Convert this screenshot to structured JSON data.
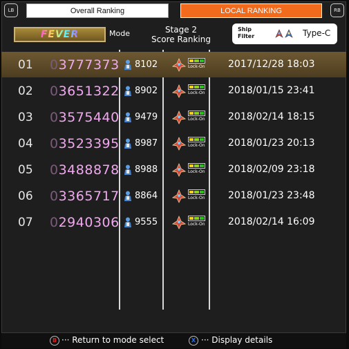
{
  "header": {
    "lb_label": "LB",
    "rb_label": "RB",
    "tabs": [
      {
        "label": "Overall Ranking",
        "active": false
      },
      {
        "label": "LOCAL RANKING",
        "active": true
      }
    ],
    "mode_badge": "FEVER",
    "mode_label": "Mode",
    "stage_line1": "Stage  2",
    "stage_line2": "Score Ranking",
    "filter_label_line1": "Ship",
    "filter_label_line2": "Filter",
    "filter_value": "Type-C"
  },
  "colors": {
    "accent_tab": "#f26a1b",
    "score": "#f2a8f0",
    "highlight_row": "#6d5831"
  },
  "rankings": [
    {
      "rank": "01",
      "score_prefix": "0",
      "score": "3777373",
      "pilot_number": "8102",
      "lockon_label": "Lock-On",
      "date": "2017/12/28 18:03",
      "highlighted": true
    },
    {
      "rank": "02",
      "score_prefix": "0",
      "score": "3651322",
      "pilot_number": "8902",
      "lockon_label": "Lock-On",
      "date": "2018/01/15 23:41",
      "highlighted": false
    },
    {
      "rank": "03",
      "score_prefix": "0",
      "score": "3575440",
      "pilot_number": "9479",
      "lockon_label": "Lock-On",
      "date": "2018/02/14 18:15",
      "highlighted": false
    },
    {
      "rank": "04",
      "score_prefix": "0",
      "score": "3523395",
      "pilot_number": "8987",
      "lockon_label": "Lock-On",
      "date": "2018/01/23 20:13",
      "highlighted": false
    },
    {
      "rank": "05",
      "score_prefix": "0",
      "score": "3488878",
      "pilot_number": "8988",
      "lockon_label": "Lock-On",
      "date": "2018/02/09 23:18",
      "highlighted": false
    },
    {
      "rank": "06",
      "score_prefix": "0",
      "score": "3365717",
      "pilot_number": "8864",
      "lockon_label": "Lock-On",
      "date": "2018/01/23 23:48",
      "highlighted": false
    },
    {
      "rank": "07",
      "score_prefix": "0",
      "score": "2940306",
      "pilot_number": "9555",
      "lockon_label": "Lock-On",
      "date": "2018/02/14 16:09",
      "highlighted": false
    }
  ],
  "footer": {
    "b_button": "B",
    "b_hint": "··· Return to mode select",
    "x_button": "X",
    "x_hint": "··· Display details"
  }
}
